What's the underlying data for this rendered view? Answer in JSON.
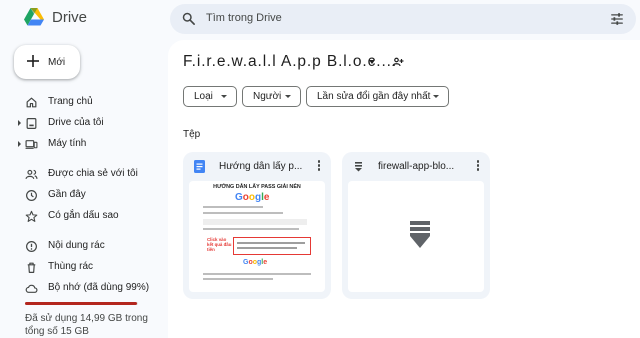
{
  "app": {
    "name": "Drive"
  },
  "search": {
    "placeholder": "Tìm trong Drive"
  },
  "new_button": {
    "label": "Mới"
  },
  "sidebar": {
    "items": [
      {
        "label": "Trang chủ",
        "icon": "home-icon"
      },
      {
        "label": "Drive của tôi",
        "icon": "my-drive-icon"
      },
      {
        "label": "Máy tính",
        "icon": "computer-icon"
      },
      {
        "label": "Được chia sẻ với tôi",
        "icon": "shared-icon"
      },
      {
        "label": "Gần đây",
        "icon": "clock-icon"
      },
      {
        "label": "Có gắn dấu sao",
        "icon": "star-icon"
      },
      {
        "label": "Nội dung rác",
        "icon": "spam-icon"
      },
      {
        "label": "Thùng rác",
        "icon": "trash-icon"
      },
      {
        "label": "Bộ nhớ (đã dùng 99%)",
        "icon": "cloud-icon"
      }
    ]
  },
  "storage": {
    "used_fraction": 0.99,
    "bar_color": "#b3261e",
    "text": "Đã sử dụng 14,99 GB trong tổng số 15 GB"
  },
  "main": {
    "folder_title": "F.i.r.e.w.a.l.l A.p.p B.l.o.c....",
    "filters": [
      "Loại",
      "Người",
      "Lần sửa đổi gần đây nhất"
    ],
    "section_label": "Tệp",
    "files": [
      {
        "name": "Hướng dẫn lấy p...",
        "type": "doc",
        "icon_color": "#4285f4"
      },
      {
        "name": "firewall-app-blo...",
        "type": "file"
      }
    ]
  },
  "doc_preview": {
    "heading": "HƯỚNG DẪN LẤY PASS GIẢI NÉN",
    "logo": [
      "G",
      "o",
      "o",
      "g",
      "l",
      "e"
    ],
    "note": "Click vào kết quả đầu tiên"
  },
  "colors": {
    "accent": "#0b57d0",
    "sidebar_bg": "#f8fafd",
    "search_bg": "#e9eef6",
    "card_bg": "#f0f4f9"
  }
}
